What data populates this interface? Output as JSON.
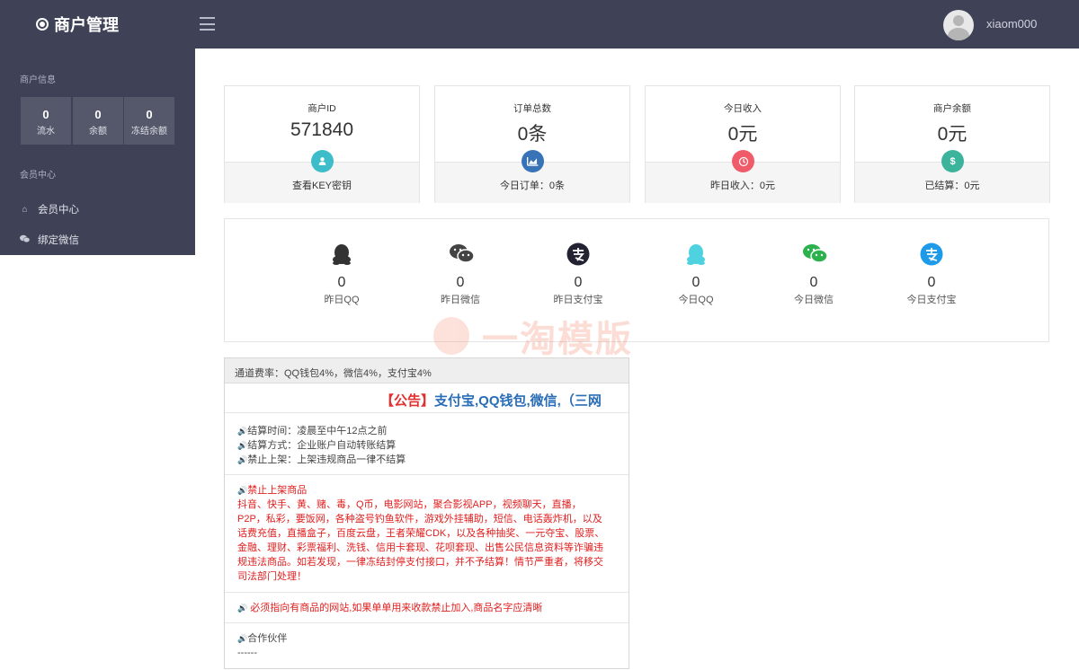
{
  "topbar": {
    "brand": "商户管理",
    "username": "xiaom000"
  },
  "sidebar": {
    "info_title": "商户信息",
    "stats": [
      {
        "value": "0",
        "label": "流水"
      },
      {
        "value": "0",
        "label": "余额"
      },
      {
        "value": "0",
        "label": "冻结余额"
      }
    ],
    "member_title": "会员中心",
    "items": [
      {
        "label": "会员中心",
        "icon": "home-icon"
      },
      {
        "label": "绑定微信",
        "icon": "wechat-icon"
      }
    ]
  },
  "cards": [
    {
      "title": "商户ID",
      "value": "571840",
      "footer": "查看KEY密钥",
      "icon": "user-icon",
      "color": "#3dbdc9"
    },
    {
      "title": "订单总数",
      "value": "0条",
      "footer": "今日订单：0条",
      "icon": "chart-icon",
      "color": "#3773b6"
    },
    {
      "title": "今日收入",
      "value": "0元",
      "footer": "昨日收入：0元",
      "icon": "clock-icon",
      "color": "#ef5b69"
    },
    {
      "title": "商户余额",
      "value": "0元",
      "footer": "已结算：0元",
      "icon": "dollar-icon",
      "color": "#3cb49c"
    }
  ],
  "payments": [
    {
      "value": "0",
      "label": "昨日QQ",
      "icon": "qq-icon",
      "color": "#333333"
    },
    {
      "value": "0",
      "label": "昨日微信",
      "icon": "wechat-icon",
      "color": "#444444"
    },
    {
      "value": "0",
      "label": "昨日支付宝",
      "icon": "alipay-icon",
      "color": "#222233"
    },
    {
      "value": "0",
      "label": "今日QQ",
      "icon": "qq-icon",
      "color": "#4fd2e0"
    },
    {
      "value": "0",
      "label": "今日微信",
      "icon": "wechat-icon",
      "color": "#2bb24c"
    },
    {
      "value": "0",
      "label": "今日支付宝",
      "icon": "alipay-icon",
      "color": "#1e9be8"
    }
  ],
  "watermark": "一淘模版",
  "notice": {
    "header": "通道费率：QQ钱包4%，微信4%，支付宝4%",
    "marquee_tag": "【公告】",
    "marquee_text": "支付宝,QQ钱包,微信,（三网",
    "settle_lines": [
      "结算时间：凌晨至中午12点之前",
      "结算方式：企业账户自动转账结算",
      "禁止上架：上架违规商品一律不结算"
    ],
    "ban_title": "禁止上架商品",
    "ban_lines": [
      "抖音、快手、黄、赌、毒，Q币，电影网站，聚合影视APP，视频聊天，直播，",
      "P2P，私彩，要饭网，各种盗号钓鱼软件，游戏外挂辅助，短信、电话轰炸机，以及",
      "话费充值，直播盒子，百度云盘，王者荣耀CDK，以及各种抽奖、一元夺宝、股票、",
      "金融、理财、彩票福利、洗钱、信用卡套现、花呗套现、出售公民信息资料等诈骗违",
      "规违法商品。如若发现，一律冻结封停支付接口，并不予结算！情节严重者，将移交",
      "司法部门处理！"
    ],
    "must_line": "必须指向有商品的网站,如果单单用来收款禁止加入,商品名字应清晰",
    "partner_title": "合作伙伴",
    "partner_text": "------"
  }
}
